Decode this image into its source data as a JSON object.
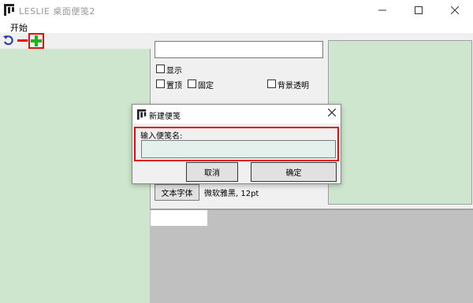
{
  "window": {
    "title": "LESLIE 桌面便笺2",
    "menu_start": "开始"
  },
  "toolbar": {
    "refresh_icon": "refresh-icon",
    "remove_icon": "minus-icon",
    "add_icon": "plus-icon",
    "accent_add": "#1db31d",
    "accent_remove": "#e01010"
  },
  "settings": {
    "name_value": "",
    "show_label": "显示",
    "pin_top_label": "置顶",
    "fixed_label": "固定",
    "transparent_label": "背景透明",
    "font_button_label": "文本字体",
    "font_info": "微软雅黑, 12pt"
  },
  "dialog": {
    "title": "新建便笺",
    "label": "输入便笺名:",
    "input_value": "",
    "cancel_label": "取消",
    "ok_label": "确定",
    "highlight_color": "#e01010"
  },
  "colors": {
    "note_green": "#cde6cd",
    "bottom_gray": "#c0c0c0"
  }
}
